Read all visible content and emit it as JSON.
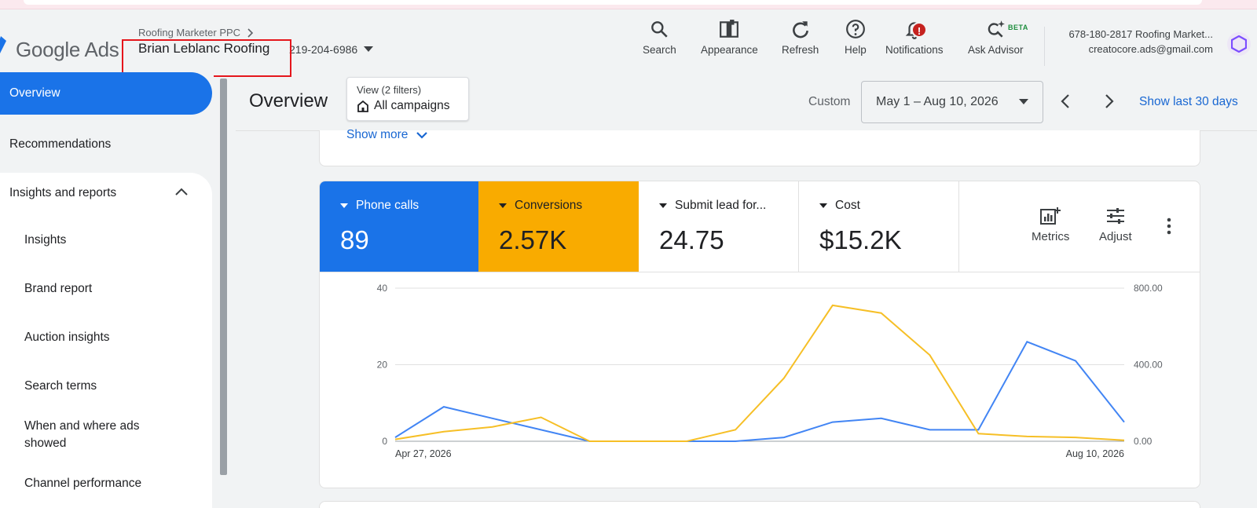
{
  "header": {
    "logo_google": "Google",
    "logo_ads": "Ads",
    "breadcrumb": "Roofing Marketer PPC",
    "account_name": "Brian Leblanc Roofing",
    "account_id": "219-204-6986",
    "tools": [
      {
        "label": "Search",
        "icon": "search-icon"
      },
      {
        "label": "Appearance",
        "icon": "appearance-icon"
      },
      {
        "label": "Refresh",
        "icon": "refresh-icon"
      },
      {
        "label": "Help",
        "icon": "help-icon"
      },
      {
        "label": "Notifications",
        "icon": "bell-icon"
      },
      {
        "label": "Ask Advisor",
        "icon": "advisor-icon"
      }
    ],
    "notification_badge": "!",
    "beta_label": "BETA",
    "account_line1": "678-180-2817 Roofing Market...",
    "account_line2": "creatocore.ads@gmail.com"
  },
  "sidebar": {
    "overview": "Overview",
    "recommendations": "Recommendations",
    "insights_group": "Insights and reports",
    "sub_items": [
      "Insights",
      "Brand report",
      "Auction insights",
      "Search terms",
      "When and where ads showed",
      "Channel performance"
    ]
  },
  "page": {
    "title": "Overview",
    "view_filters": "View (2 filters)",
    "view_scope": "All campaigns",
    "custom_label": "Custom",
    "date_range": "May 1 – Aug 10, 2026",
    "show_last": "Show last 30 days",
    "show_more": "Show more"
  },
  "metrics": {
    "tiles": [
      {
        "name": "Phone calls",
        "value": "89"
      },
      {
        "name": "Conversions",
        "value": "2.57K"
      },
      {
        "name": "Submit lead for...",
        "value": "24.75"
      },
      {
        "name": "Cost",
        "value": "$15.2K"
      }
    ],
    "metrics_button": "Metrics",
    "adjust_button": "Adjust"
  },
  "colors": {
    "accent_blue": "#1a73e8",
    "conversions_yellow": "#f9ab00",
    "phone_line": "#4285f4",
    "conv_line": "#f6bf26"
  },
  "chart_data": {
    "type": "line",
    "x_labels": [
      "Apr 27, 2026",
      "Aug 10, 2026"
    ],
    "left_axis": {
      "ticks": [
        "0",
        "20",
        "40"
      ],
      "ylim": [
        0,
        40
      ]
    },
    "right_axis": {
      "ticks": [
        "0.00",
        "400.00",
        "800.00"
      ],
      "ylim": [
        0,
        800
      ]
    },
    "grid": true,
    "series": [
      {
        "name": "Phone calls",
        "axis": "left",
        "values": [
          1,
          9,
          6,
          3,
          0,
          0,
          0,
          0,
          1,
          5,
          6,
          3,
          3,
          26,
          21,
          5
        ]
      },
      {
        "name": "Conversions",
        "axis": "right",
        "values": [
          10,
          50,
          75,
          125,
          0,
          0,
          0,
          60,
          330,
          710,
          670,
          450,
          40,
          25,
          20,
          5
        ]
      }
    ]
  }
}
